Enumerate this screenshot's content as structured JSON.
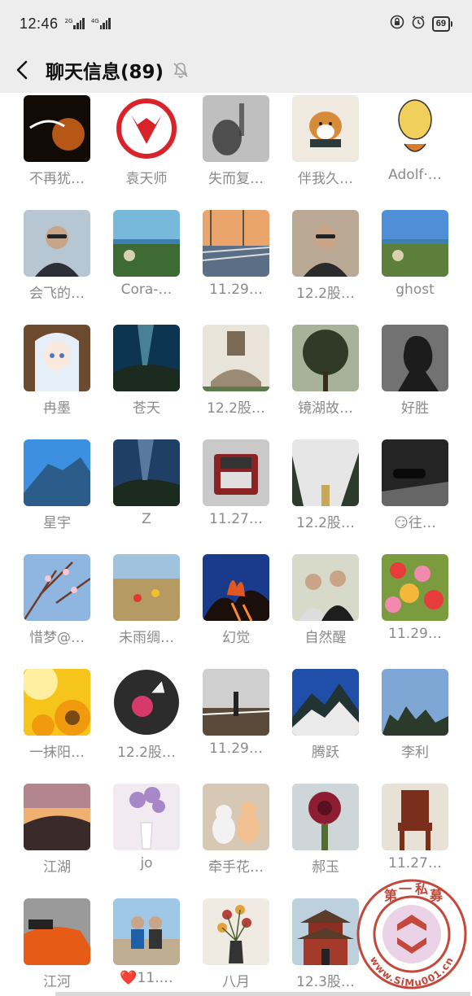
{
  "status_bar": {
    "time": "12:46",
    "sim1": "2G",
    "sim2": "4G",
    "battery": "69"
  },
  "header": {
    "title": "聊天信息(89)"
  },
  "members": [
    {
      "name": "不再犹…",
      "avatar_colors": [
        "#2a1508",
        "#e06a1c"
      ],
      "kind": "dark-art"
    },
    {
      "name": "袁天师",
      "avatar_colors": [
        "#ffffff",
        "#d9232a"
      ],
      "kind": "red-logo"
    },
    {
      "name": "失而复…",
      "avatar_colors": [
        "#bfbfbf",
        "#3a3a3a"
      ],
      "kind": "shadow"
    },
    {
      "name": "伴我久…",
      "avatar_colors": [
        "#efe9df",
        "#d88a3b"
      ],
      "kind": "dog"
    },
    {
      "name": "Adolf·…",
      "avatar_colors": [
        "#ffffff",
        "#e6b422"
      ],
      "kind": "caricature"
    },
    {
      "name": "会飞的…",
      "avatar_colors": [
        "#b7c6d3",
        "#2c2f38"
      ],
      "kind": "person"
    },
    {
      "name": "Cora-…",
      "avatar_colors": [
        "#78b8d8",
        "#3d6b33"
      ],
      "kind": "landscape"
    },
    {
      "name": "11.29…",
      "avatar_colors": [
        "#e9a56b",
        "#5a6e86"
      ],
      "kind": "sunset-rail"
    },
    {
      "name": "12.2股…",
      "avatar_colors": [
        "#b9a995",
        "#2b2b2b"
      ],
      "kind": "person"
    },
    {
      "name": "ghost",
      "avatar_colors": [
        "#4f8fd8",
        "#5d7f3c"
      ],
      "kind": "landscape"
    },
    {
      "name": "冉墨",
      "avatar_colors": [
        "#e8d6bd",
        "#a9c6e8"
      ],
      "kind": "anime"
    },
    {
      "name": "苍天",
      "avatar_colors": [
        "#0d3450",
        "#6fb4c8"
      ],
      "kind": "sky-dark"
    },
    {
      "name": "12.2股…",
      "avatar_colors": [
        "#c9c4b6",
        "#7a6a55"
      ],
      "kind": "tower"
    },
    {
      "name": "镜湖故…",
      "avatar_colors": [
        "#6f7b61",
        "#2f3b27"
      ],
      "kind": "tree"
    },
    {
      "name": "好胜",
      "avatar_colors": [
        "#e8e8e8",
        "#1c1c1c"
      ],
      "kind": "silhouette"
    },
    {
      "name": "星宇",
      "avatar_colors": [
        "#3d8fe0",
        "#2b5c8a"
      ],
      "kind": "mountain"
    },
    {
      "name": "Z",
      "avatar_colors": [
        "#1f3f66",
        "#7fa1c7"
      ],
      "kind": "sky-dark"
    },
    {
      "name": "11.27…",
      "avatar_colors": [
        "#c9c9c9",
        "#8a2424"
      ],
      "kind": "truck"
    },
    {
      "name": "12.2股…",
      "avatar_colors": [
        "#e6e6e6",
        "#2d3b2d"
      ],
      "kind": "fog"
    },
    {
      "name": "😏往…",
      "avatar_colors": [
        "#242424",
        "#a8a8a8"
      ],
      "kind": "car-dark"
    },
    {
      "name": "惜梦@…",
      "avatar_colors": [
        "#8fb6e0",
        "#6b3b2b"
      ],
      "kind": "blossom"
    },
    {
      "name": "未雨绸…",
      "avatar_colors": [
        "#9fc3dd",
        "#b59a64"
      ],
      "kind": "beach"
    },
    {
      "name": "幻觉",
      "avatar_colors": [
        "#1a3b8c",
        "#e2561f"
      ],
      "kind": "fire"
    },
    {
      "name": "自然醒",
      "avatar_colors": [
        "#d7d9c9",
        "#1e1e1e"
      ],
      "kind": "couple"
    },
    {
      "name": "11.29…",
      "avatar_colors": [
        "#7a9c3f",
        "#e83b3b"
      ],
      "kind": "flowers"
    },
    {
      "name": "一抹阳…",
      "avatar_colors": [
        "#f6c51b",
        "#f29a0e"
      ],
      "kind": "sunflower"
    },
    {
      "name": "12.2股…",
      "avatar_colors": [
        "#f2f2f2",
        "#d63a6c"
      ],
      "kind": "circle-flower"
    },
    {
      "name": "11.29…",
      "avatar_colors": [
        "#cfcfcf",
        "#5a4a3a"
      ],
      "kind": "farm"
    },
    {
      "name": "腾跃",
      "avatar_colors": [
        "#1f4fa8",
        "#eaeaea"
      ],
      "kind": "snow-mountain"
    },
    {
      "name": "李利",
      "avatar_colors": [
        "#7ea7d6",
        "#2c3a2c"
      ],
      "kind": "rocks"
    },
    {
      "name": "江湖",
      "avatar_colors": [
        "#c97a3a",
        "#3b2a2a"
      ],
      "kind": "dusk"
    },
    {
      "name": "jo",
      "avatar_colors": [
        "#f1eaf0",
        "#a887c9"
      ],
      "kind": "vase"
    },
    {
      "name": "牵手花…",
      "avatar_colors": [
        "#d6c8b4",
        "#f2f2f2"
      ],
      "kind": "cats"
    },
    {
      "name": "郝玉",
      "avatar_colors": [
        "#cfd6d9",
        "#8c1d33"
      ],
      "kind": "rose"
    },
    {
      "name": "11.27…",
      "avatar_colors": [
        "#e8e1d6",
        "#7a2f1c"
      ],
      "kind": "chair"
    },
    {
      "name": "江河",
      "avatar_colors": [
        "#9a9a9a",
        "#e65c17"
      ],
      "kind": "car-orange"
    },
    {
      "name": "❤️11.…",
      "avatar_colors": [
        "#9fc7e6",
        "#6b5b4b"
      ],
      "kind": "couple-beach"
    },
    {
      "name": "八月",
      "avatar_colors": [
        "#efeae2",
        "#b8423a"
      ],
      "kind": "flower-vase"
    },
    {
      "name": "12.3股…",
      "avatar_colors": [
        "#bcd0de",
        "#5b3c28"
      ],
      "kind": "temple"
    },
    {
      "name": "",
      "avatar_colors": [
        "#c4c4c4",
        "#8a8a8a"
      ],
      "kind": "hidden"
    }
  ],
  "watermark": {
    "char_1": "第",
    "char_2": "一",
    "char_3": "私",
    "char_4": "募",
    "url": "www.SiMu001.cn",
    "ring_color": "#c0392b"
  }
}
